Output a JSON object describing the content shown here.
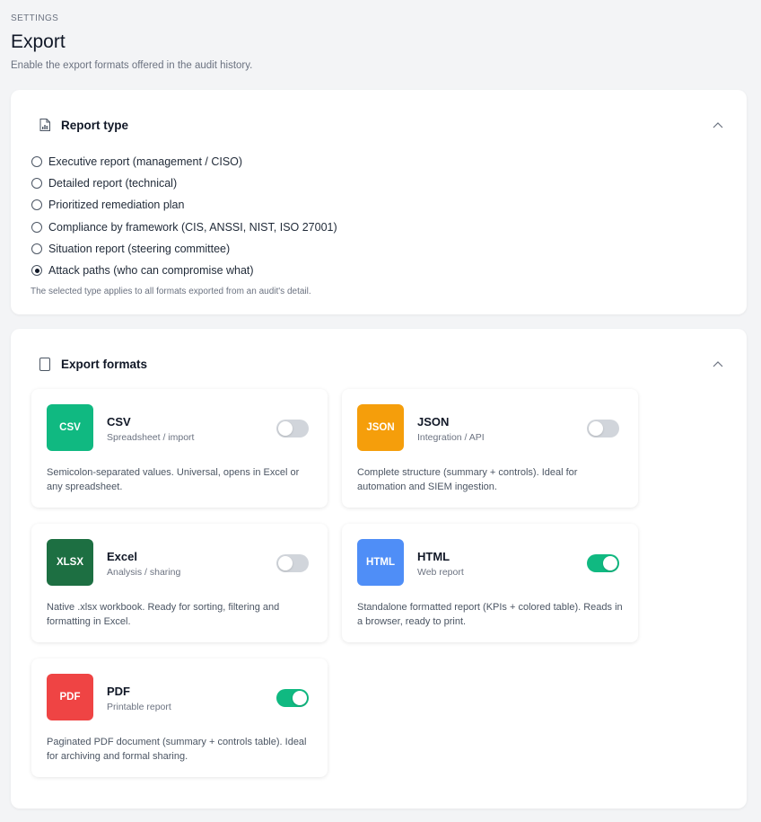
{
  "header": {
    "eyebrow": "SETTINGS",
    "title": "Export",
    "subtitle": "Enable the export formats offered in the audit history."
  },
  "report_type": {
    "title": "Report type",
    "icon": "report-icon",
    "options": [
      {
        "label": "Executive report (management / CISO)",
        "selected": false
      },
      {
        "label": "Detailed report (technical)",
        "selected": false
      },
      {
        "label": "Prioritized remediation plan",
        "selected": false
      },
      {
        "label": "Compliance by framework (CIS, ANSSI, NIST, ISO 27001)",
        "selected": false
      },
      {
        "label": "Situation report (steering committee)",
        "selected": false
      },
      {
        "label": "Attack paths (who can compromise what)",
        "selected": true
      }
    ],
    "note": "The selected type applies to all formats exported from an audit's detail."
  },
  "export_formats": {
    "title": "Export formats",
    "icon": "document-icon",
    "formats": [
      {
        "badge": "CSV",
        "name": "CSV",
        "subtitle": "Spreadsheet / import",
        "enabled": false,
        "color": "#10b981",
        "description": "Semicolon-separated values. Universal, opens in Excel or any spreadsheet."
      },
      {
        "badge": "JSON",
        "name": "JSON",
        "subtitle": "Integration / API",
        "enabled": false,
        "color": "#f59e0b",
        "description": "Complete structure (summary + controls). Ideal for automation and SIEM ingestion."
      },
      {
        "badge": "XLSX",
        "name": "Excel",
        "subtitle": "Analysis / sharing",
        "enabled": false,
        "color": "#1d6f42",
        "description": "Native .xlsx workbook. Ready for sorting, filtering and formatting in Excel."
      },
      {
        "badge": "HTML",
        "name": "HTML",
        "subtitle": "Web report",
        "enabled": true,
        "color": "#4f8ef7",
        "description": "Standalone formatted report (KPIs + colored table). Reads in a browser, ready to print."
      },
      {
        "badge": "PDF",
        "name": "PDF",
        "subtitle": "Printable report",
        "enabled": true,
        "color": "#ef4444",
        "description": "Paginated PDF document (summary + controls table). Ideal for archiving and formal sharing."
      }
    ]
  },
  "colors": {
    "toggle_on": "#10b981",
    "toggle_off": "#d1d5db"
  }
}
